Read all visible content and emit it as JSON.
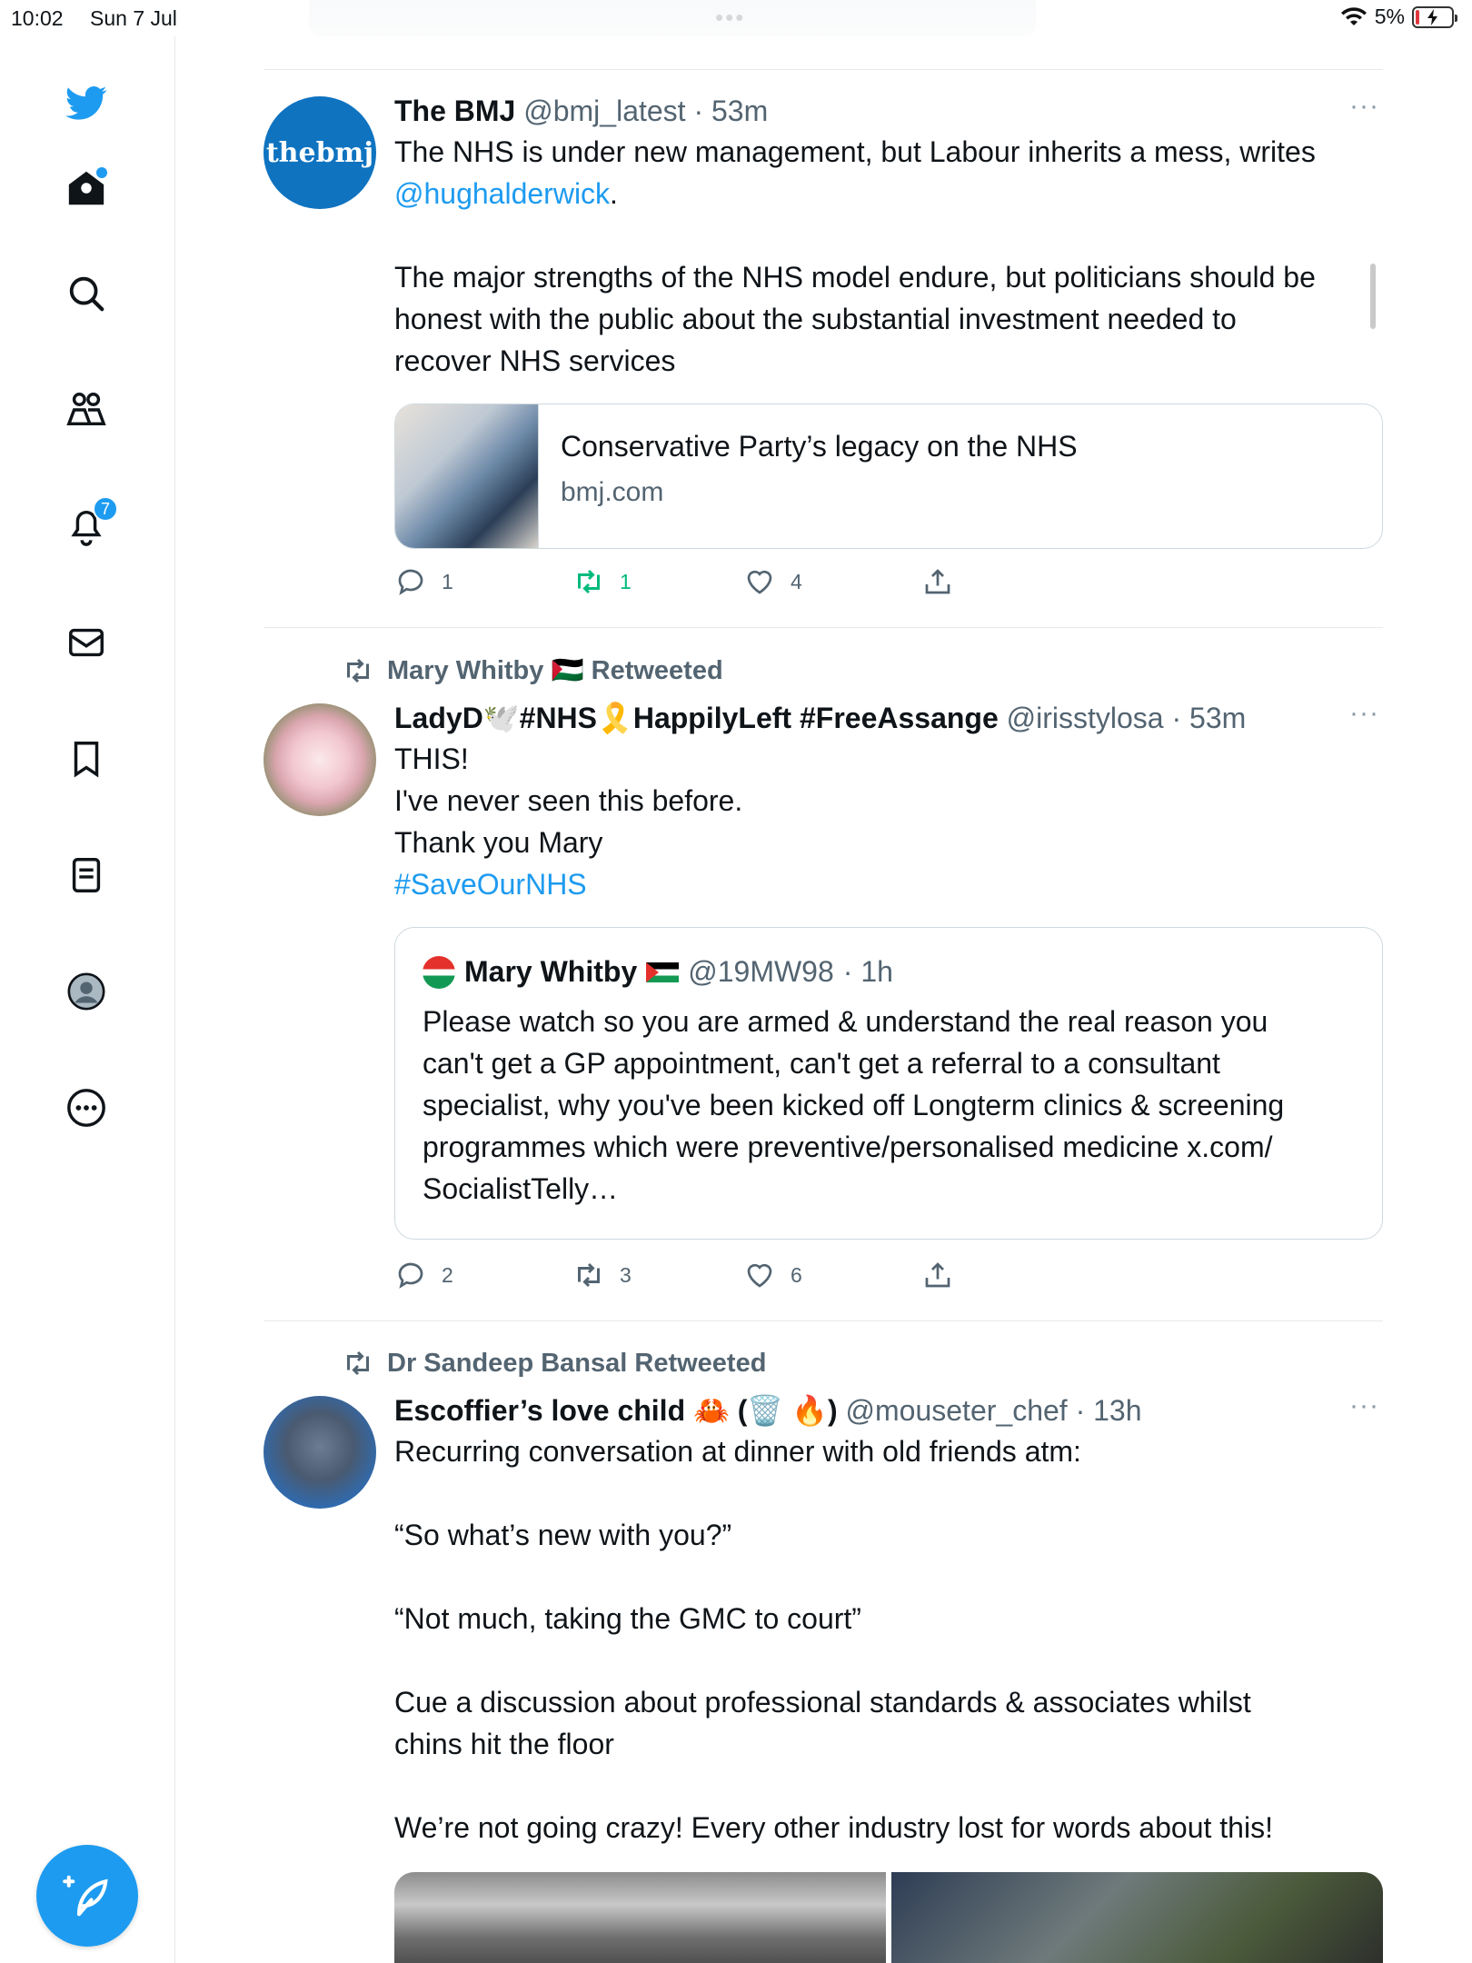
{
  "status_bar": {
    "time": "10:02",
    "date": "Sun 7 Jul",
    "more": "•••",
    "battery": "5%"
  },
  "sidebar": {
    "notification_count": "7"
  },
  "tweets": [
    {
      "name": "The BMJ",
      "handle": "@bmj_latest",
      "time": "· 53m",
      "avatar_text": "thebmj",
      "more": "···",
      "body_line1": "The NHS is under new management, but Labour inherits a mess, writes",
      "body_mention": "@hughalderwick",
      "body_mention_end": ".",
      "body_para2": [
        "The major strengths of the NHS model endure, but politicians should be",
        "honest with the public about the substantial investment needed to",
        "recover NHS services"
      ],
      "card": {
        "title": "Conservative Party’s legacy on the NHS",
        "domain": "bmj.com"
      },
      "replies": "1",
      "retweets": "1",
      "likes": "4"
    },
    {
      "retweeted_by": "Mary Whitby 🇵🇸 Retweeted",
      "name": "LadyD🕊️#NHS🎗️HappilyLeft #FreeAssange",
      "handle": "@irisstylosa",
      "time": "· 53m",
      "more": "···",
      "lines": [
        "THIS!",
        "I've never seen this before.",
        "Thank you Mary"
      ],
      "hashtag": "#SaveOurNHS",
      "quote": {
        "name": "Mary Whitby",
        "handle": "@19MW98",
        "time": "· 1h",
        "lines": [
          "Please watch so you are armed & understand the real reason you",
          "can't get a GP appointment,   can't get a referral to a consultant",
          "specialist, why you've been kicked off Longterm clinics & screening",
          "programmes which were preventive/personalised medicine x.com/",
          "SocialistTelly…"
        ]
      },
      "replies": "2",
      "retweets": "3",
      "likes": "6"
    },
    {
      "retweeted_by": "Dr Sandeep Bansal Retweeted",
      "name": "Escoffier’s love child 🦀 (🗑️ 🔥)",
      "handle": "@mouseter_chef",
      "time": "· 13h",
      "more": "···",
      "para1": "Recurring conversation at dinner with  old friends atm:",
      "para2": "“So what’s new with you?”",
      "para3": "“Not much, taking the GMC to court”",
      "para4": [
        "Cue a discussion about professional standards & associates whilst",
        "chins hit the floor"
      ],
      "para5": "We’re not going crazy! Every other industry lost for words about this!"
    }
  ],
  "colors": {
    "accent": "#1d9bf0",
    "retweet": "#00ba7c",
    "muted": "#536471"
  }
}
